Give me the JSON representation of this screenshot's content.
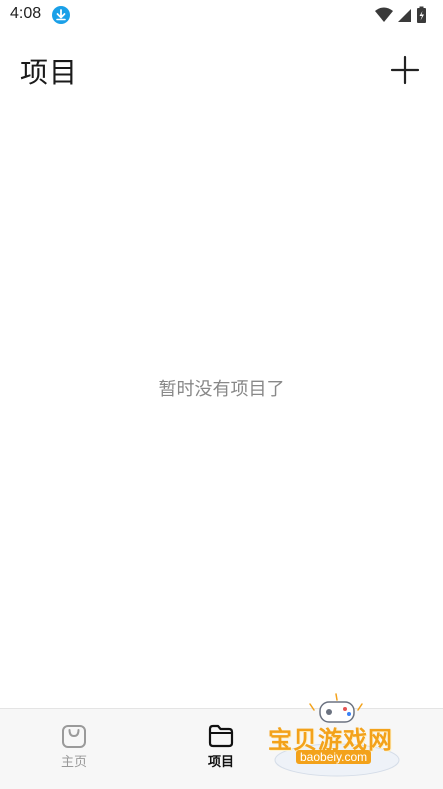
{
  "status_bar": {
    "time": "4:08",
    "icons": [
      "download-icon",
      "wifi-icon",
      "signal-icon",
      "battery-icon"
    ]
  },
  "header": {
    "title": "项目",
    "add_icon": "plus-icon"
  },
  "empty_state": {
    "message": "暂时没有项目了"
  },
  "bottom_nav": {
    "items": [
      {
        "label": "主页",
        "icon": "shopping-bag-icon",
        "active": false
      },
      {
        "label": "项目",
        "icon": "folder-icon",
        "active": true
      }
    ]
  },
  "watermark": {
    "text": "宝贝游戏网",
    "url": "baobeiy.com"
  },
  "colors": {
    "accent_download": "#1aa0e8",
    "watermark": "#f3a21b",
    "muted_text": "#888888"
  }
}
